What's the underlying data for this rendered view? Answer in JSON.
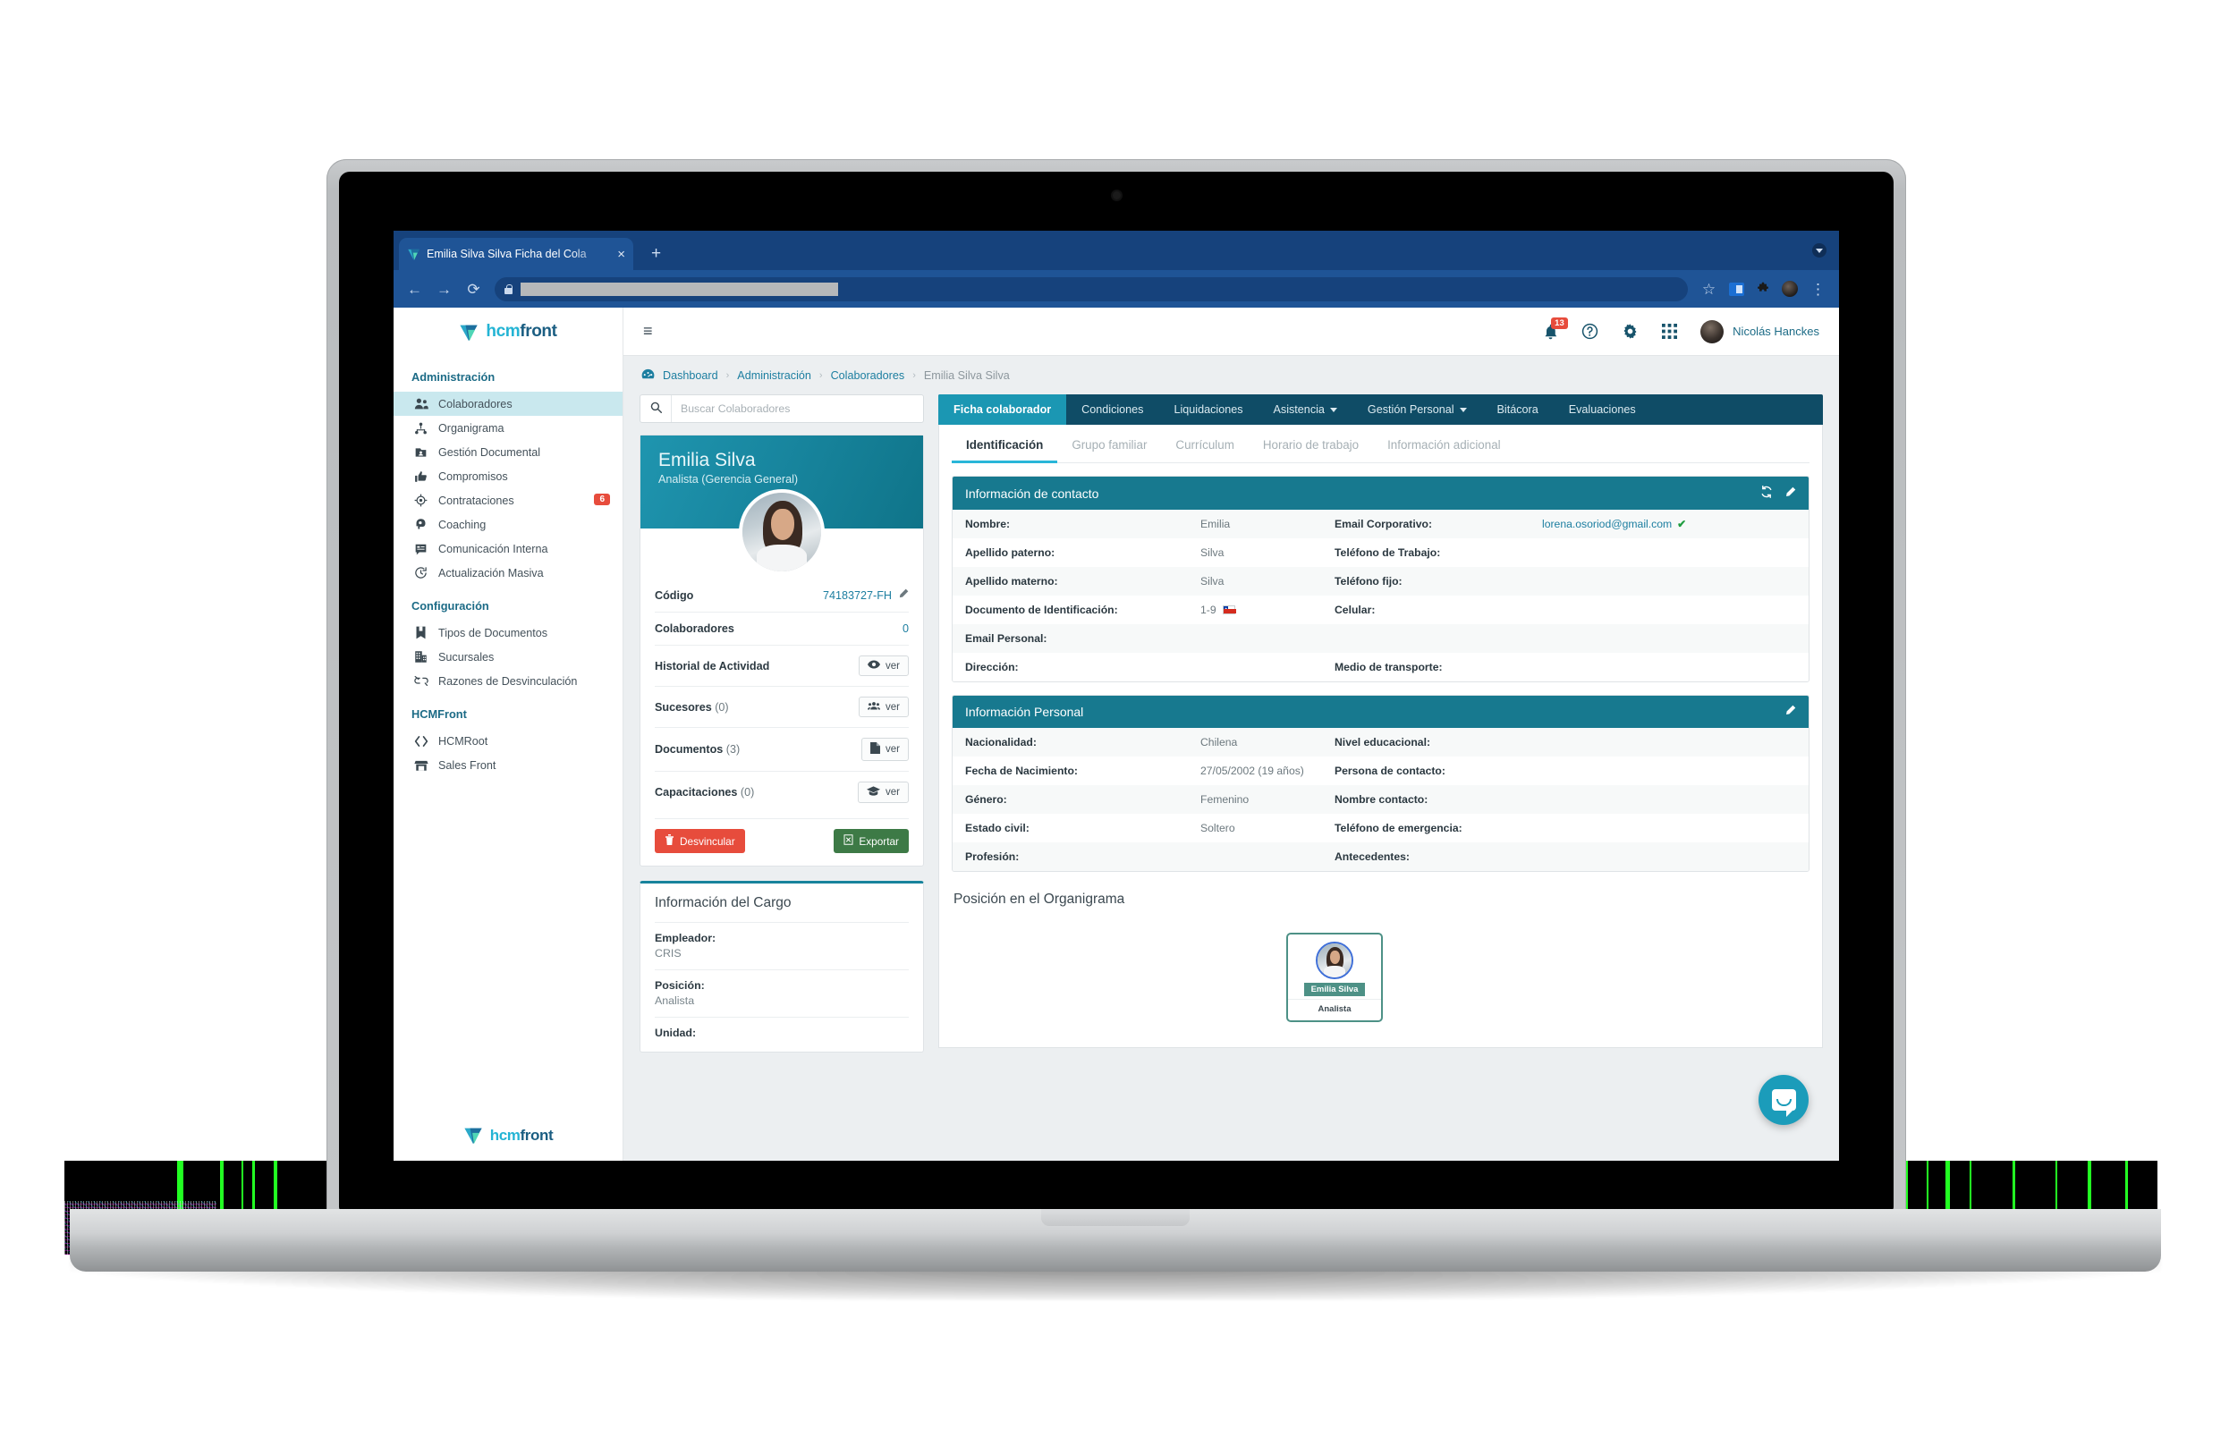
{
  "browser": {
    "tab_title": "Emilia Silva Silva Ficha del Cola",
    "tab_close": "×",
    "new_tab": "+",
    "back": "←",
    "forward": "→",
    "reload": "⟳",
    "star": "☆",
    "menu": "⋮",
    "url_value": ""
  },
  "brand": {
    "a": "hcm",
    "b": "front"
  },
  "sidebar": {
    "groups": [
      {
        "title": "Administración",
        "items": [
          {
            "label": "Colaboradores",
            "icon": "people-icon",
            "active": true,
            "badge": ""
          },
          {
            "label": "Organigrama",
            "icon": "org-chart-icon",
            "active": false,
            "badge": ""
          },
          {
            "label": "Gestión Documental",
            "icon": "document-folder-icon",
            "active": false,
            "badge": ""
          },
          {
            "label": "Compromisos",
            "icon": "thumbs-up-icon",
            "active": false,
            "badge": ""
          },
          {
            "label": "Contrataciones",
            "icon": "target-icon",
            "active": false,
            "badge": "6"
          },
          {
            "label": "Coaching",
            "icon": "head-idea-icon",
            "active": false,
            "badge": ""
          },
          {
            "label": "Comunicación Interna",
            "icon": "comment-list-icon",
            "active": false,
            "badge": ""
          },
          {
            "label": "Actualización Masiva",
            "icon": "refresh-clock-icon",
            "active": false,
            "badge": ""
          }
        ]
      },
      {
        "title": "Configuración",
        "items": [
          {
            "label": "Tipos de Documentos",
            "icon": "book-icon",
            "active": false,
            "badge": ""
          },
          {
            "label": "Sucursales",
            "icon": "building-icon",
            "active": false,
            "badge": ""
          },
          {
            "label": "Razones de Desvinculación",
            "icon": "broken-link-icon",
            "active": false,
            "badge": ""
          }
        ]
      },
      {
        "title": "HCMFront",
        "items": [
          {
            "label": "HCMRoot",
            "icon": "code-icon",
            "active": false,
            "badge": ""
          },
          {
            "label": "Sales Front",
            "icon": "store-icon",
            "active": false,
            "badge": ""
          }
        ]
      }
    ]
  },
  "header": {
    "hamburger": "≡",
    "bell_badge": "13",
    "help": "?",
    "user_name": "Nicolás Hanckes"
  },
  "breadcrumb": {
    "items": [
      {
        "label": "Dashboard",
        "last": false
      },
      {
        "label": "Administración",
        "last": false
      },
      {
        "label": "Colaboradores",
        "last": false
      },
      {
        "label": "Emilia Silva Silva",
        "last": true
      }
    ],
    "sep": "›"
  },
  "search": {
    "placeholder": "Buscar Colaboradores",
    "value": ""
  },
  "profile": {
    "name": "Emilia Silva",
    "role": "Analista (Gerencia General)",
    "rows": [
      {
        "label": "Código",
        "count": "",
        "value": "74183727-FH",
        "type": "value-edit"
      },
      {
        "label": "Colaboradores",
        "count": "",
        "value": "0",
        "type": "value"
      },
      {
        "label": "Historial de Actividad",
        "count": "",
        "value": "ver",
        "type": "button",
        "icon": "eye-icon"
      },
      {
        "label": "Sucesores",
        "count": "(0)",
        "value": "ver",
        "type": "button",
        "icon": "users-icon"
      },
      {
        "label": "Documentos",
        "count": "(3)",
        "value": "ver",
        "type": "button",
        "icon": "file-icon"
      },
      {
        "label": "Capacitaciones",
        "count": "(0)",
        "value": "ver",
        "type": "button",
        "icon": "graduation-cap-icon"
      }
    ],
    "btn_desvincular": "Desvincular",
    "btn_exportar": "Exportar"
  },
  "cargo": {
    "title": "Información del Cargo",
    "rows": [
      {
        "label": "Empleador:",
        "value": "CRIS"
      },
      {
        "label": "Posición:",
        "value": "Analista"
      },
      {
        "label": "Unidad:",
        "value": ""
      }
    ]
  },
  "main_tabs": [
    {
      "label": "Ficha colaborador",
      "active": true,
      "caret": false
    },
    {
      "label": "Condiciones",
      "active": false,
      "caret": false
    },
    {
      "label": "Liquidaciones",
      "active": false,
      "caret": false
    },
    {
      "label": "Asistencia",
      "active": false,
      "caret": true
    },
    {
      "label": "Gestión Personal",
      "active": false,
      "caret": true
    },
    {
      "label": "Bitácora",
      "active": false,
      "caret": false
    },
    {
      "label": "Evaluaciones",
      "active": false,
      "caret": false
    }
  ],
  "sub_tabs": [
    {
      "label": "Identificación",
      "active": true
    },
    {
      "label": "Grupo familiar",
      "active": false
    },
    {
      "label": "Currículum",
      "active": false
    },
    {
      "label": "Horario de trabajo",
      "active": false
    },
    {
      "label": "Información adicional",
      "active": false
    }
  ],
  "contact_section": {
    "title": "Información de contacto",
    "rows": [
      {
        "k": "Nombre:",
        "v": "Emilia",
        "k2": "Email Corporativo:",
        "v2": "lorena.osoriod@gmail.com",
        "verified": true,
        "flag": false
      },
      {
        "k": "Apellido paterno:",
        "v": "Silva",
        "k2": "Teléfono de Trabajo:",
        "v2": "",
        "verified": false,
        "flag": false
      },
      {
        "k": "Apellido materno:",
        "v": "Silva",
        "k2": "Teléfono fijo:",
        "v2": "",
        "verified": false,
        "flag": false
      },
      {
        "k": "Documento de Identificación:",
        "v": "1-9",
        "k2": "Celular:",
        "v2": "",
        "verified": false,
        "flag": true
      },
      {
        "k": "Email Personal:",
        "v": "",
        "k2": "",
        "v2": "",
        "verified": false,
        "flag": false
      },
      {
        "k": "Dirección:",
        "v": "",
        "k2": "Medio de transporte:",
        "v2": "",
        "verified": false,
        "flag": false
      }
    ]
  },
  "personal_section": {
    "title": "Información Personal",
    "rows": [
      {
        "k": "Nacionalidad:",
        "v": "Chilena",
        "k2": "Nivel educacional:",
        "v2": ""
      },
      {
        "k": "Fecha de Nacimiento:",
        "v": "27/05/2002 (19 años)",
        "k2": "Persona de contacto:",
        "v2": ""
      },
      {
        "k": "Género:",
        "v": "Femenino",
        "k2": "Nombre contacto:",
        "v2": ""
      },
      {
        "k": "Estado civil:",
        "v": "Soltero",
        "k2": "Teléfono de emergencia:",
        "v2": ""
      },
      {
        "k": "Profesión:",
        "v": "",
        "k2": "Antecedentes:",
        "v2": ""
      }
    ]
  },
  "organigram": {
    "title": "Posición en el Organigrama",
    "node_name": "Emilia Silva",
    "node_role": "Analista"
  },
  "colors": {
    "accent_teal": "#17798f",
    "tab_active": "#1b97b3",
    "tab_bar": "#0f4c66",
    "link": "#1c7ea0",
    "danger": "#e74c3c",
    "success": "#3d7a46",
    "sidebar_active": "#c9e8ee",
    "underline": "#29b6d8",
    "chat_fab": "#1b9cba"
  }
}
